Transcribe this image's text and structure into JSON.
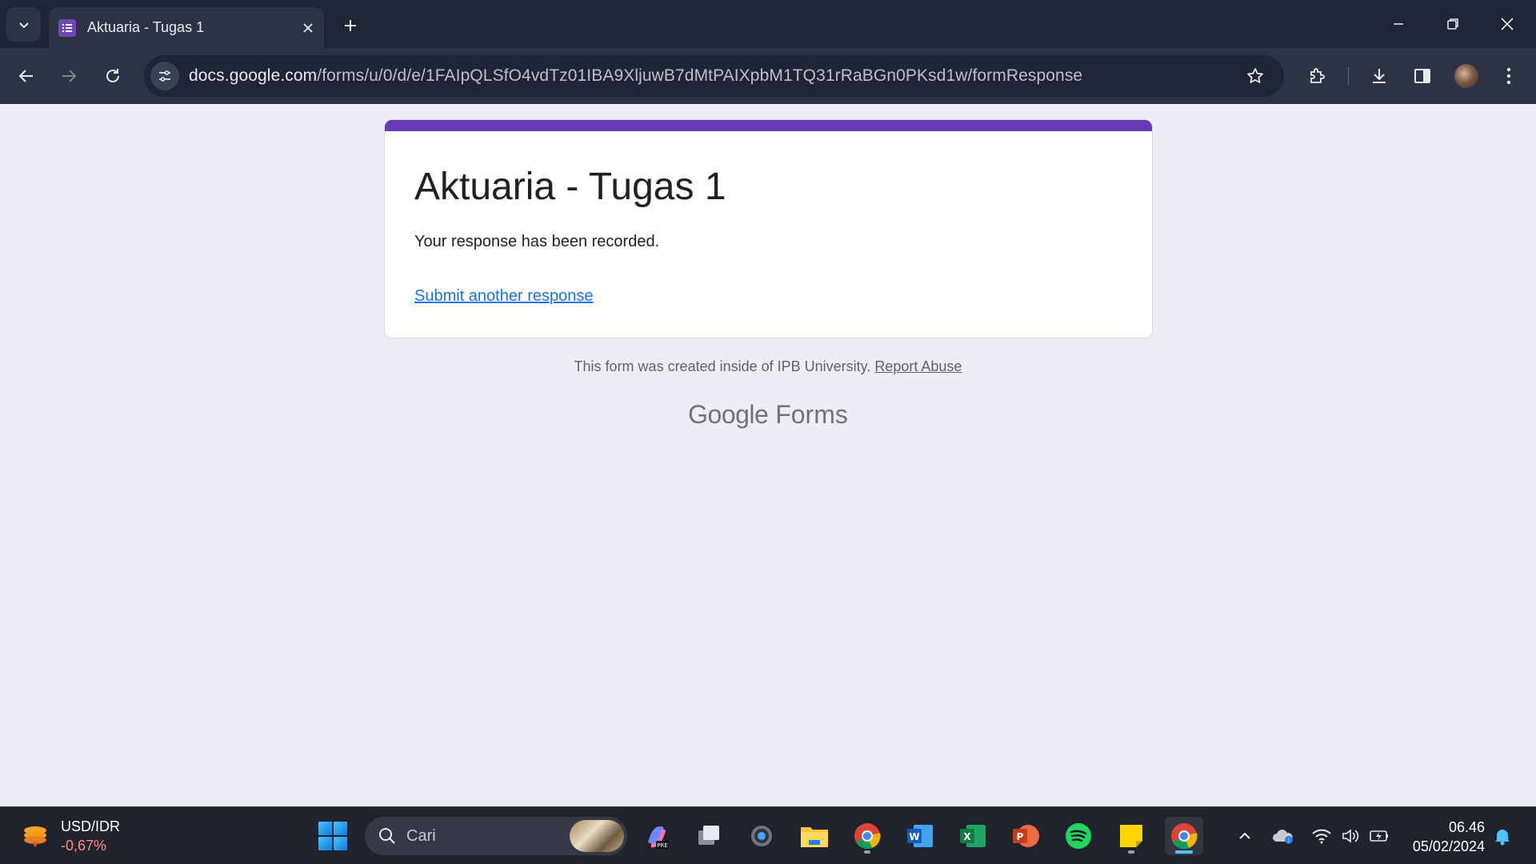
{
  "browser": {
    "tab_title": "Aktuaria - Tugas 1",
    "url_host": "docs.google.com",
    "url_path": "/forms/u/0/d/e/1FAIpQLSfO4vdTz01IBA9XljuwB7dMtPAIXpbM1TQ31rRaBGn0PKsd1w/formResponse"
  },
  "form": {
    "title": "Aktuaria - Tugas 1",
    "confirmation": "Your response has been recorded.",
    "another_link": "Submit another response",
    "footer_note": "This form was created inside of IPB University.",
    "report_link": "Report Abuse",
    "brand_google": "Google",
    "brand_forms": "Forms"
  },
  "taskbar": {
    "ticker_name": "USD/IDR",
    "ticker_change": "-0,67%",
    "search_label": "Cari",
    "time": "06.46",
    "date": "05/02/2024"
  },
  "colors": {
    "form_accent": "#673ab7",
    "link": "#1a73e8",
    "page_bg": "#f0ebf8"
  }
}
